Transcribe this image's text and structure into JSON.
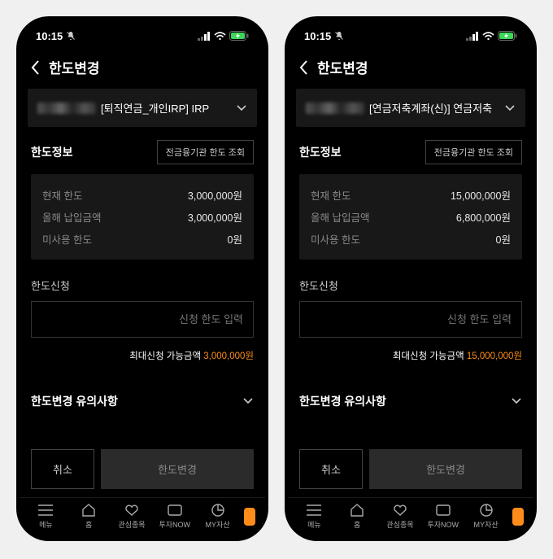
{
  "status": {
    "time": "10:15"
  },
  "header": {
    "title": "한도변경"
  },
  "screens": [
    {
      "account_label": "[퇴직연금_개인IRP] IRP",
      "limit_section_title": "한도정보",
      "query_button": "전금융기관 한도 조회",
      "rows": {
        "current_limit_label": "현재 한도",
        "current_limit_value": "3,000,000원",
        "year_deposit_label": "올해 납입금액",
        "year_deposit_value": "3,000,000원",
        "unused_label": "미사용 한도",
        "unused_value": "0원"
      },
      "apply_title": "한도신청",
      "input_placeholder": "신청 한도 입력",
      "max_prefix": "최대신청 가능금액 ",
      "max_value": "3,000,000원",
      "notice_title": "한도변경 유의사항",
      "cancel": "취소",
      "submit": "한도변경"
    },
    {
      "account_label": "[연금저축계좌(신)] 연금저축",
      "limit_section_title": "한도정보",
      "query_button": "전금융기관 한도 조회",
      "rows": {
        "current_limit_label": "현재 한도",
        "current_limit_value": "15,000,000원",
        "year_deposit_label": "올해 납입금액",
        "year_deposit_value": "6,800,000원",
        "unused_label": "미사용 한도",
        "unused_value": "0원"
      },
      "apply_title": "한도신청",
      "input_placeholder": "신청 한도 입력",
      "max_prefix": "최대신청 가능금액 ",
      "max_value": "15,000,000원",
      "notice_title": "한도변경 유의사항",
      "cancel": "취소",
      "submit": "한도변경"
    }
  ],
  "nav": {
    "menu": "메뉴",
    "home": "홈",
    "watchlist": "관심종목",
    "invest_now": "투자NOW",
    "my_assets": "MY자산"
  }
}
